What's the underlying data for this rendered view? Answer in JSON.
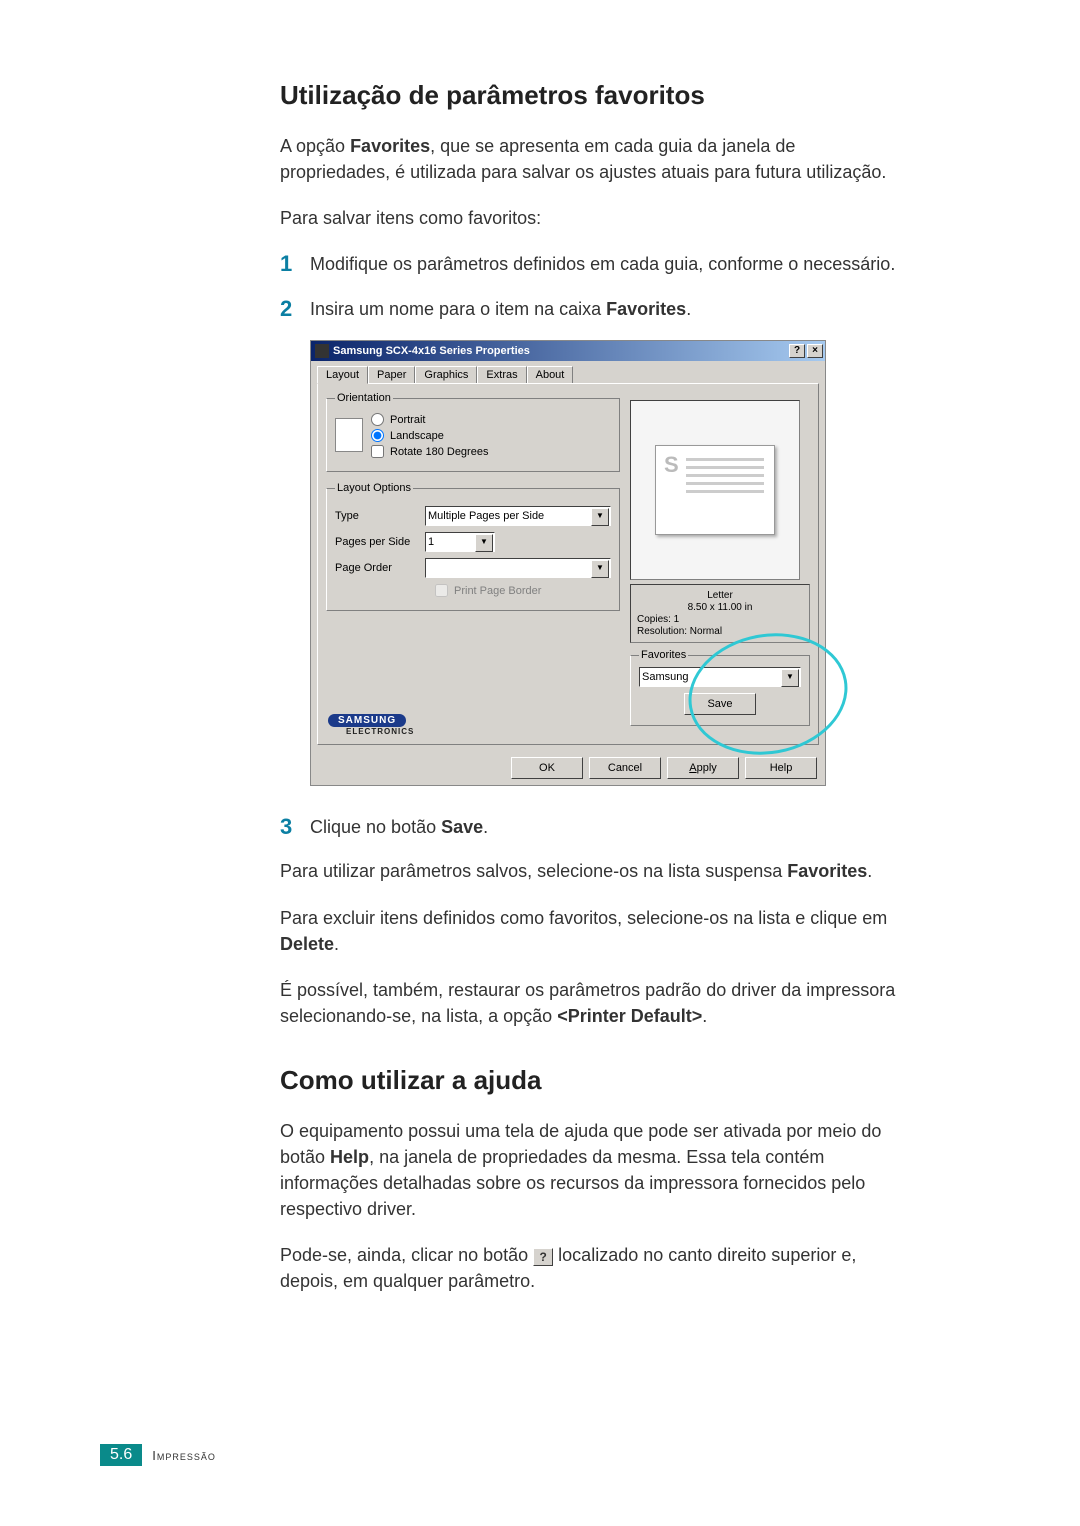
{
  "heading1": "Utilização de parâmetros favoritos",
  "para1_a": "A opção ",
  "para1_b": "Favorites",
  "para1_c": ", que se apresenta em cada guia da janela de propriedades, é utilizada para salvar os ajustes atuais para futura utilização.",
  "para2": "Para salvar itens como favoritos:",
  "step1_num": "1",
  "step1_text": "Modifique os parâmetros definidos em cada guia, conforme o necessário.",
  "step2_num": "2",
  "step2_text_a": "Insira um nome para o item na caixa ",
  "step2_text_b": "Favorites",
  "step2_text_c": ".",
  "dialog": {
    "title": "Samsung SCX-4x16 Series Properties",
    "help_btn": "?",
    "close_btn": "×",
    "tabs": [
      "Layout",
      "Paper",
      "Graphics",
      "Extras",
      "About"
    ],
    "orientation": {
      "legend": "Orientation",
      "portrait": "Portrait",
      "landscape": "Landscape",
      "rotate": "Rotate 180 Degrees"
    },
    "layout_options": {
      "legend": "Layout Options",
      "type_label": "Type",
      "type_value": "Multiple Pages per Side",
      "pps_label": "Pages per Side",
      "pps_value": "1",
      "order_label": "Page Order",
      "order_value": "",
      "print_border": "Print Page Border"
    },
    "info": {
      "paper": "Letter",
      "size": "8.50 x 11.00 in",
      "copies": "Copies: 1",
      "resolution": "Resolution: Normal"
    },
    "favorites": {
      "legend": "Favorites",
      "value": "Samsung",
      "save": "Save"
    },
    "logo": "SAMSUNG",
    "logo_sub": "ELECTRONICS",
    "buttons": {
      "ok": "OK",
      "cancel": "Cancel",
      "apply": "Apply",
      "help": "Help"
    }
  },
  "step3_num": "3",
  "step3_text_a": "Clique no botão ",
  "step3_text_b": "Save",
  "step3_text_c": ".",
  "para3_a": "Para utilizar parâmetros salvos, selecione-os na lista suspensa ",
  "para3_b": "Favorites",
  "para3_c": ".",
  "para4_a": "Para excluir itens definidos como favoritos, selecione-os na lista e clique em ",
  "para4_b": "Delete",
  "para4_c": ".",
  "para5_a": "É possível, também, restaurar os parâmetros padrão do driver da impressora selecionando-se, na lista, a opção ",
  "para5_b": "<Printer Default>",
  "para5_c": ".",
  "heading2": "Como utilizar a ajuda",
  "para6_a": "O equipamento possui uma tela de ajuda que pode ser ativada por meio do botão ",
  "para6_b": "Help",
  "para6_c": ", na janela de propriedades da mesma. Essa tela contém informações detalhadas sobre os recursos da impressora fornecidos pelo respectivo driver.",
  "para7_a": "Pode-se, ainda, clicar no botão ",
  "para7_help": "?",
  "para7_b": " localizado no canto direito superior e, depois, em qualquer parâmetro.",
  "footer_page": "5.6",
  "footer_text": "Impressão"
}
